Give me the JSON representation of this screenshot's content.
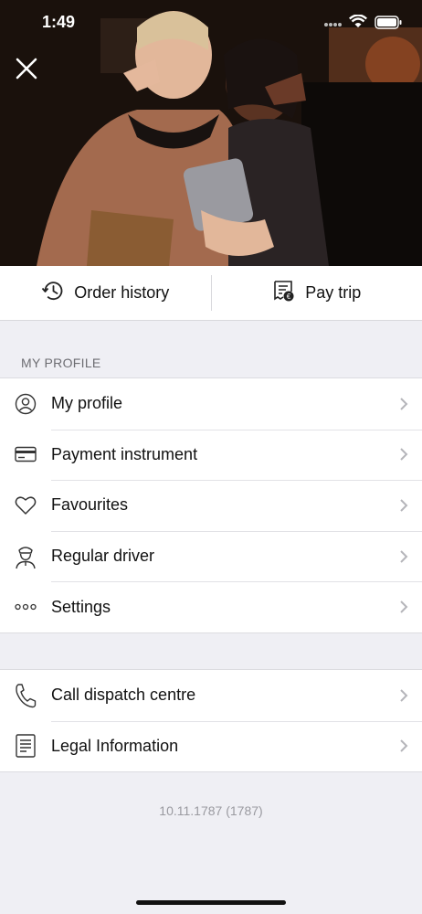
{
  "status_bar": {
    "time": "1:49"
  },
  "hero": {
    "image": "photo of two women in a car back seat making peace signs and taking a selfie"
  },
  "actions": {
    "order_history": {
      "label": "Order history",
      "icon": "history-clock-icon"
    },
    "pay_trip": {
      "label": "Pay trip",
      "icon": "receipt-payment-icon"
    }
  },
  "profile_section": {
    "header": "MY PROFILE",
    "items": [
      {
        "label": "My profile",
        "icon": "user-circle-icon"
      },
      {
        "label": "Payment instrument",
        "icon": "credit-card-icon"
      },
      {
        "label": "Favourites",
        "icon": "heart-icon"
      },
      {
        "label": "Regular driver",
        "icon": "driver-icon"
      },
      {
        "label": "Settings",
        "icon": "more-dots-icon"
      }
    ]
  },
  "support_section": {
    "items": [
      {
        "label": "Call dispatch centre",
        "icon": "phone-icon"
      },
      {
        "label": "Legal Information",
        "icon": "document-icon"
      }
    ]
  },
  "version": "10.11.1787 (1787)"
}
